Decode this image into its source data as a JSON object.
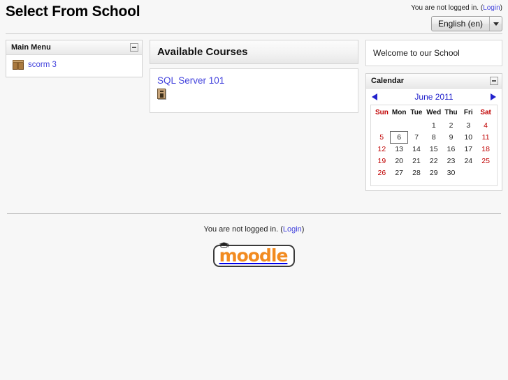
{
  "header": {
    "site_title": "Select From School",
    "login_status_prefix": "You are not logged in. (",
    "login_link": "Login",
    "login_status_suffix": ")",
    "language_selected": "English (en)",
    "language_options": [
      "English (en)"
    ]
  },
  "main_menu_block": {
    "title": "Main Menu",
    "collapse_icon": "minus-icon",
    "items": [
      {
        "label": "scorm 3",
        "icon": "scorm-package-icon"
      }
    ]
  },
  "courses": {
    "heading": "Available Courses",
    "list": [
      {
        "name": "SQL Server 101",
        "icon": "course-summary-icon"
      }
    ]
  },
  "welcome_block": {
    "text": "Welcome to our School"
  },
  "calendar_block": {
    "title": "Calendar",
    "collapse_icon": "minus-icon",
    "prev_icon": "triangle-left-icon",
    "next_icon": "triangle-right-icon",
    "month_label": "June 2011",
    "day_headers": [
      "Sun",
      "Mon",
      "Tue",
      "Wed",
      "Thu",
      "Fri",
      "Sat"
    ],
    "weekend_columns": [
      0,
      6
    ],
    "today": 6,
    "weeks": [
      [
        "",
        "",
        "",
        "1",
        "2",
        "3",
        "4"
      ],
      [
        "5",
        "6",
        "7",
        "8",
        "9",
        "10",
        "11"
      ],
      [
        "12",
        "13",
        "14",
        "15",
        "16",
        "17",
        "18"
      ],
      [
        "19",
        "20",
        "21",
        "22",
        "23",
        "24",
        "25"
      ],
      [
        "26",
        "27",
        "28",
        "29",
        "30",
        "",
        ""
      ]
    ],
    "colors": {
      "weekend": "#c00000",
      "weekday": "#222222",
      "link": "#2222cc"
    }
  },
  "footer": {
    "login_status_prefix": "You are not logged in. (",
    "login_link": "Login",
    "login_status_suffix": ")",
    "logo_text": "moodle",
    "logo_icon": "graduation-cap-icon",
    "logo_color": "#f28b20"
  }
}
